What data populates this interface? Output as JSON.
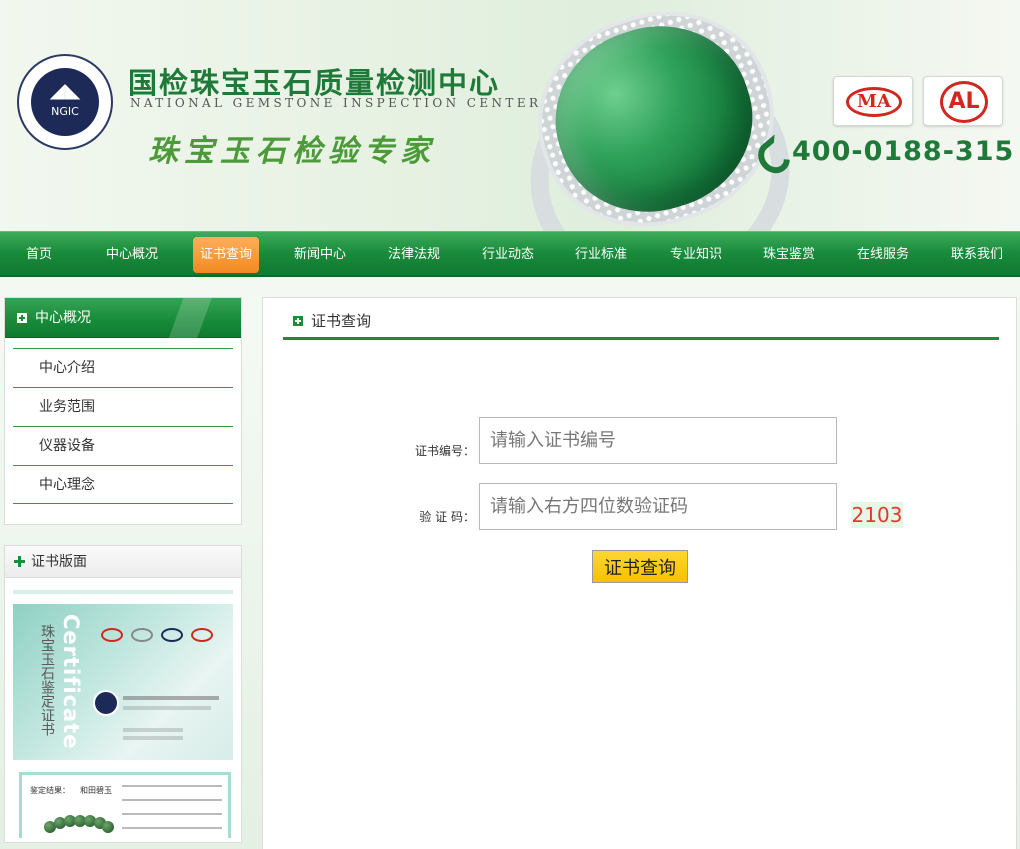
{
  "header": {
    "logo_text": "NGIC",
    "title_cn": "国检珠宝玉石质量检测中心",
    "title_en": "NATIONAL GEMSTONE INSPECTION CENTER",
    "slogan": "珠宝玉石检验专家",
    "badge_ma": "MA",
    "badge_al": "AL",
    "hotline": "400-0188-315"
  },
  "nav": {
    "items": [
      {
        "label": "首页"
      },
      {
        "label": "中心概况"
      },
      {
        "label": "证书查询"
      },
      {
        "label": "新闻中心"
      },
      {
        "label": "法律法规"
      },
      {
        "label": "行业动态"
      },
      {
        "label": "行业标准"
      },
      {
        "label": "专业知识"
      },
      {
        "label": "珠宝鉴赏"
      },
      {
        "label": "在线服务"
      },
      {
        "label": "联系我们"
      }
    ],
    "active": "证书查询"
  },
  "sidebar": {
    "about_title": "中心概况",
    "about_items": [
      {
        "label": "中心介绍"
      },
      {
        "label": "业务范围"
      },
      {
        "label": "仪器设备"
      },
      {
        "label": "中心理念"
      }
    ],
    "cert_title": "证书版面",
    "cert_sample": {
      "vertical_cn": "珠宝玉石鉴定证书",
      "vertical_en": "Certificate",
      "result_label": "鉴定结果：",
      "result_value": "和田碧玉"
    }
  },
  "main": {
    "section_title": "证书查询",
    "cert_no_label": "证书编号：",
    "cert_no_placeholder": "请输入证书编号",
    "captcha_label": "验 证 码：",
    "captcha_placeholder": "请输入右方四位数验证码",
    "captcha_code": "2103",
    "submit_label": "证书查询"
  },
  "colors": {
    "brand_green": "#1f8a3a",
    "nav_active": "#f28a22",
    "captcha_red": "#e23a2a",
    "submit_yellow": "#f6c100"
  }
}
